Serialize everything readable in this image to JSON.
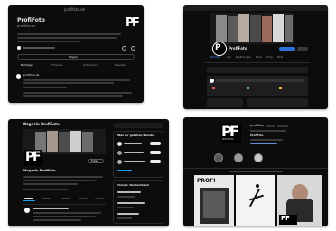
{
  "s1": {
    "url": "profifoto.de",
    "title": "ProfiFoto",
    "handle": "profifoto.de",
    "tabs": [
      "Beiträge",
      "Threads",
      "Antworten",
      "Reposts"
    ],
    "author": "profifoto.de",
    "btn": "Folgen"
  },
  "s2": {
    "tabs": [
      "Beiträge",
      "Info",
      "Erwähnungen",
      "Reels",
      "Fotos",
      "Mehr"
    ],
    "name": "ProfiFoto"
  },
  "s3": {
    "header": "Magazin ProfiFoto",
    "name": "Magazin ProfiFoto",
    "follow_btn": "Folgen",
    "sidebar_title": "Was dir gefallen könnte",
    "trend_title": "Trends: Deutschland"
  },
  "s4": {
    "username": "profifoto",
    "name": "ProfiFoto"
  },
  "logo": {
    "p": "P",
    "f": "F",
    "sub": "PROFIFOTO"
  },
  "colors": {
    "page": "#ffffff",
    "app": "#0c0c0d",
    "accent": "#2f6fd8"
  }
}
